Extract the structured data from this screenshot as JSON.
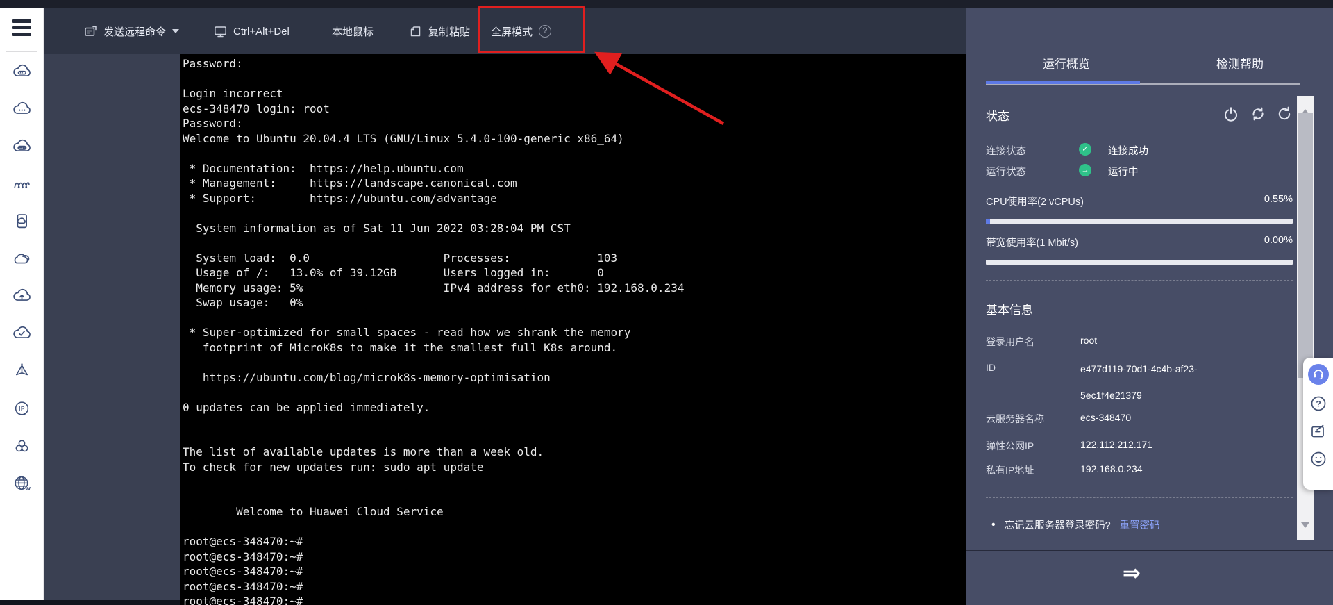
{
  "topbar": {
    "items": [
      {
        "label": "发送远程命令",
        "icon": "remote-command-icon",
        "has_dropdown": true
      },
      {
        "label": "Ctrl+Alt+Del",
        "icon": "monitor-icon"
      },
      {
        "label": "本地鼠标"
      },
      {
        "label": "复制粘贴",
        "icon": "clipboard-icon"
      },
      {
        "label": "全屏模式",
        "help": "?"
      }
    ]
  },
  "sidebar": {
    "icons": [
      "cloud-server",
      "cloud-dots",
      "cloud-dashboard",
      "waves",
      "document-cloud",
      "double-cloud",
      "cloud-upload",
      "cloud-check",
      "prism",
      "ip-badge",
      "cluster",
      "globe"
    ]
  },
  "terminal": {
    "lines": [
      "Password:",
      "",
      "Login incorrect",
      "ecs-348470 login: root",
      "Password:",
      "Welcome to Ubuntu 20.04.4 LTS (GNU/Linux 5.4.0-100-generic x86_64)",
      "",
      " * Documentation:  https://help.ubuntu.com",
      " * Management:     https://landscape.canonical.com",
      " * Support:        https://ubuntu.com/advantage",
      "",
      "  System information as of Sat 11 Jun 2022 03:28:04 PM CST",
      "",
      "  System load:  0.0                    Processes:             103",
      "  Usage of /:   13.0% of 39.12GB       Users logged in:       0",
      "  Memory usage: 5%                     IPv4 address for eth0: 192.168.0.234",
      "  Swap usage:   0%",
      "",
      " * Super-optimized for small spaces - read how we shrank the memory",
      "   footprint of MicroK8s to make it the smallest full K8s around.",
      "",
      "   https://ubuntu.com/blog/microk8s-memory-optimisation",
      "",
      "0 updates can be applied immediately.",
      "",
      "",
      "The list of available updates is more than a week old.",
      "To check for new updates run: sudo apt update",
      "",
      "",
      "        Welcome to Huawei Cloud Service",
      "",
      "root@ecs-348470:~#",
      "root@ecs-348470:~#",
      "root@ecs-348470:~#",
      "root@ecs-348470:~#",
      "root@ecs-348470:~#"
    ]
  },
  "panel": {
    "tabs": [
      {
        "label": "运行概览",
        "active": true
      },
      {
        "label": "检测帮助",
        "active": false
      }
    ],
    "status": {
      "heading": "状态",
      "actions": [
        "power-icon",
        "sync-icon",
        "refresh-icon"
      ],
      "rows": [
        {
          "label": "连接状态",
          "badge": "✓",
          "value": "连接成功"
        },
        {
          "label": "运行状态",
          "badge": "→",
          "value": "运行中"
        }
      ],
      "meters": [
        {
          "label": "CPU使用率(2 vCPUs)",
          "value": "0.55%",
          "percent": 0.55
        },
        {
          "label": "带宽使用率(1 Mbit/s)",
          "value": "0.00%",
          "percent": 0
        }
      ]
    },
    "info": {
      "heading": "基本信息",
      "rows": [
        {
          "label": "登录用户名",
          "value": "root"
        },
        {
          "label": "ID",
          "value": "e477d119-70d1-4c4b-af23-5ec1f4e21379"
        },
        {
          "label": "云服务器名称",
          "value": "ecs-348470"
        },
        {
          "label": "弹性公网IP",
          "value": "122.112.212.171"
        },
        {
          "label": "私有IP地址",
          "value": "192.168.0.234"
        }
      ]
    },
    "password_hint": {
      "bullet": "•",
      "question": "忘记云服务器登录密码?",
      "link": "重置密码"
    },
    "collapse_arrow": "⇒"
  },
  "helper": {
    "icons": [
      "headset-icon",
      "help-icon",
      "feedback-icon",
      "smiley-icon"
    ]
  },
  "colors": {
    "accent_blue": "#5d79e6",
    "green": "#2fc189",
    "annotation_red": "#e01f1f",
    "link": "#8ba2f8"
  }
}
